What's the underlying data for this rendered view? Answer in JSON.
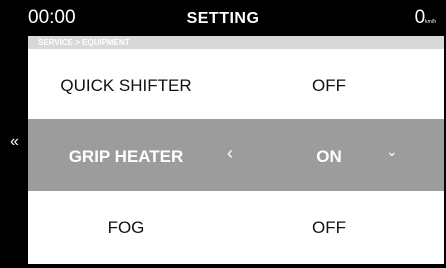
{
  "header": {
    "clock": "00:00",
    "title": "SETTING",
    "speed": "0",
    "speed_unit": "km/h"
  },
  "breadcrumb": "SERVICE > EQUIPMENT",
  "back_icon": "«",
  "rows": [
    {
      "label": "QUICK SHIFTER",
      "value": "OFF",
      "selected": false
    },
    {
      "label": "GRIP HEATER",
      "value": "ON",
      "selected": true,
      "prev_icon": "‹",
      "menu_icon": "⌄"
    },
    {
      "label": "FOG",
      "value": "OFF",
      "selected": false
    }
  ],
  "colors": {
    "background": "#000000",
    "panel": "#ffffff",
    "selected_row": "#9c9c9c",
    "breadcrumb_bar": "#d8d8d8"
  }
}
